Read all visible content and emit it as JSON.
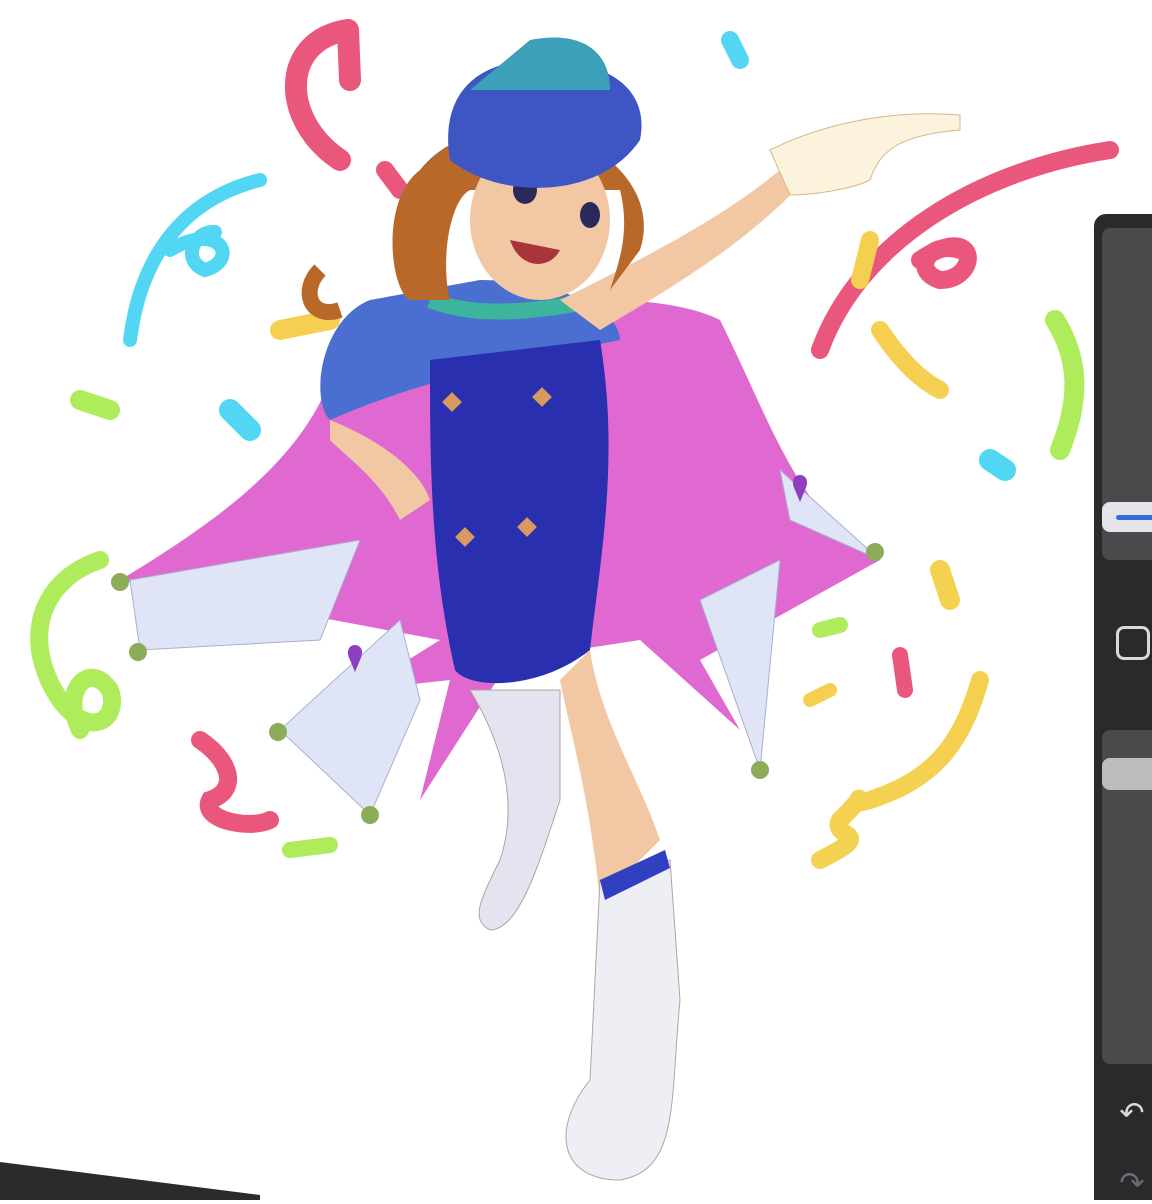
{
  "app": {
    "canvas": {
      "description_label": ""
    },
    "sidebar": {
      "brush_size_slider": {
        "level": 0.87
      },
      "opacity_slider": {
        "level": 0.1
      },
      "modify_button": {
        "icon": "square-icon"
      },
      "undo_button": {
        "icon": "undo-arrow-icon",
        "glyph": "↶"
      },
      "redo_button": {
        "icon": "redo-arrow-icon",
        "glyph": "↷"
      }
    }
  },
  "colors": {
    "panel": "#2a2a2c",
    "track": "#4a4a4d",
    "accent": "#2f6fd8",
    "confetti_pink": "#e8456e",
    "confetti_cyan": "#3fd2f2",
    "confetti_yellow": "#f4cc3e",
    "confetti_green": "#a6ea4a",
    "cape_magenta": "#d94fc8",
    "dress_blue": "#2a2fb0"
  }
}
